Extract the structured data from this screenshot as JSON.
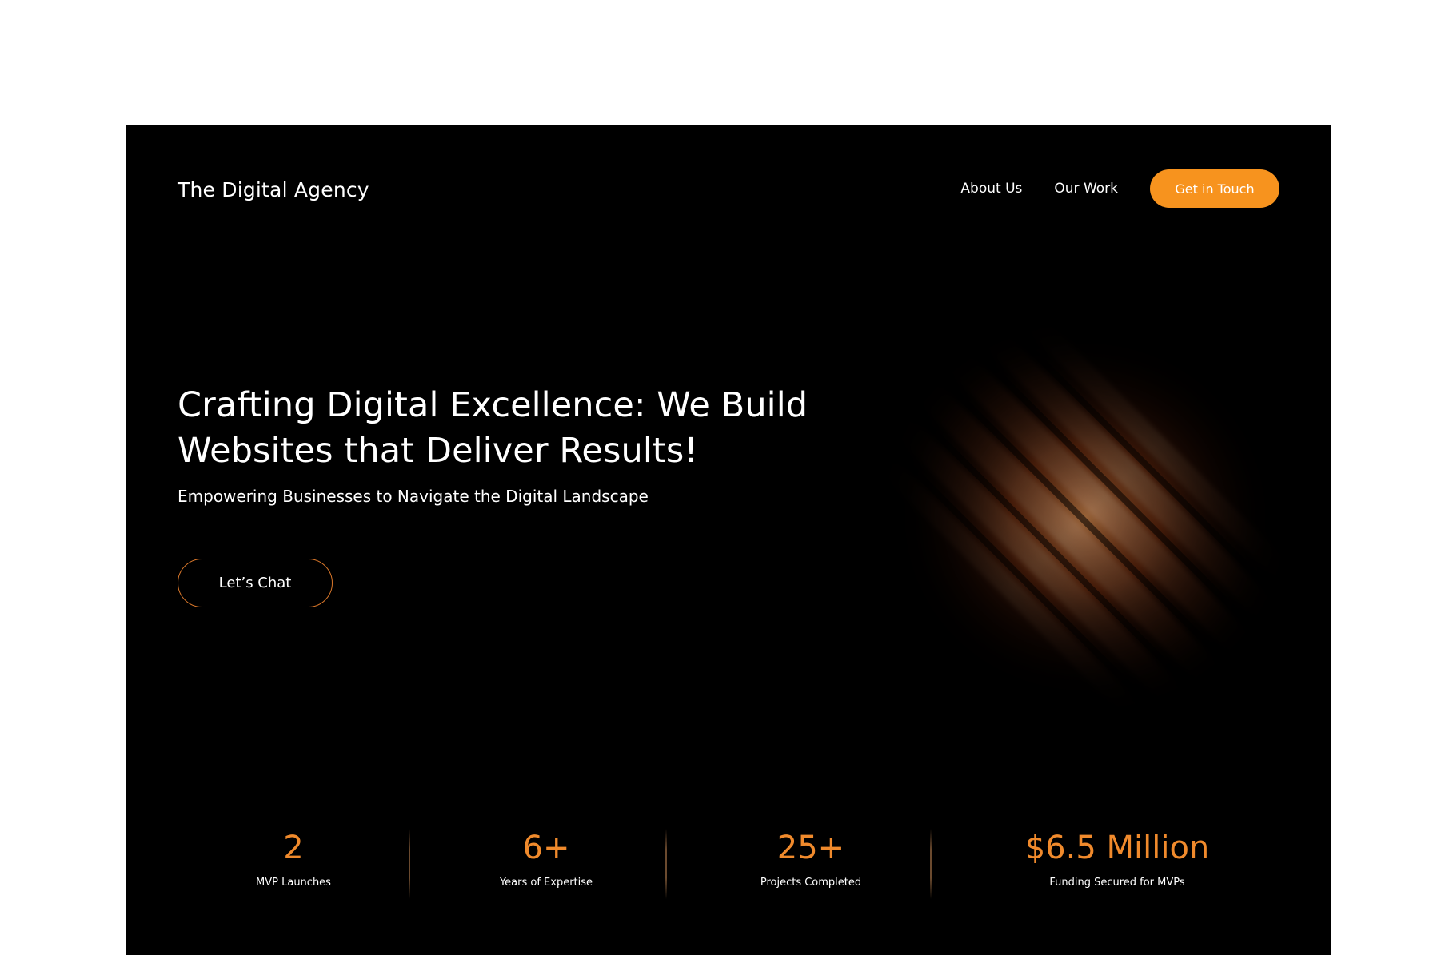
{
  "colors": {
    "accent": "#F7931E",
    "stat_value": "#F08A2C",
    "outline": "#D9772A",
    "background": "#000000"
  },
  "header": {
    "logo": "The Digital Agency",
    "nav": [
      "About Us",
      "Our Work"
    ],
    "cta_label": "Get in Touch"
  },
  "hero": {
    "title": "Crafting Digital Excellence: We Build Websites that Deliver Results!",
    "subtitle": "Empowering Businesses to Navigate the Digital Landscape",
    "button_label": "Let’s Chat"
  },
  "stats": [
    {
      "value": "2",
      "label": "MVP Launches"
    },
    {
      "value": "6+",
      "label": "Years of Expertise"
    },
    {
      "value": "25+",
      "label": "Projects Completed"
    },
    {
      "value": "$6.5 Million",
      "label": "Funding Secured for MVPs"
    }
  ]
}
